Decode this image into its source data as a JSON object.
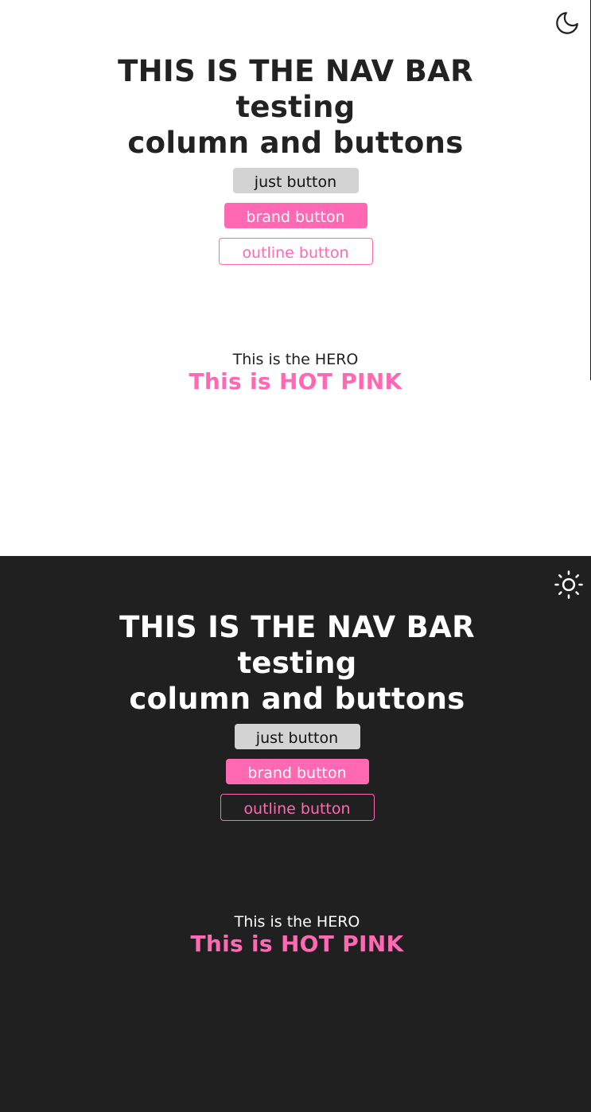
{
  "colors": {
    "brand": "#ff69b4",
    "light_bg": "#ffffff",
    "dark_bg": "#212021",
    "button_gray": "#d3d3d3"
  },
  "light": {
    "theme_icon": "moon-icon",
    "nav": {
      "title_1": "THIS IS THE NAV BAR",
      "title_2": "testing",
      "title_3": "column and buttons"
    },
    "buttons": {
      "plain": "just button",
      "brand": "brand button",
      "outline": "outline button"
    },
    "hero": {
      "text": "This is the HERO",
      "highlight": "This is HOT PINK"
    }
  },
  "dark": {
    "theme_icon": "sun-icon",
    "nav": {
      "title_1": "THIS IS THE NAV BAR",
      "title_2": "testing",
      "title_3": "column and buttons"
    },
    "buttons": {
      "plain": "just button",
      "brand": "brand button",
      "outline": "outline button"
    },
    "hero": {
      "text": "This is the HERO",
      "highlight": "This is HOT PINK"
    }
  }
}
